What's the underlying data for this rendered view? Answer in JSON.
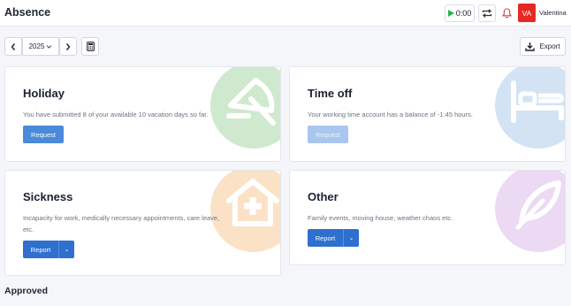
{
  "header": {
    "title": "Absence",
    "timer": "0:00",
    "avatar_initials": "VA",
    "user_name": "Valentina"
  },
  "toolbar": {
    "year": "2025",
    "export_label": "Export"
  },
  "cards": [
    {
      "title": "Holiday",
      "description": "You have submitted 8 of your available 10 vacation days so far.",
      "button": "Request",
      "color": "#cfe9cf",
      "icon": "umbrella-icon"
    },
    {
      "title": "Time off",
      "description": "Your working time account has a balance of -1:45 hours.",
      "button": "Request",
      "color": "#d3e3f3",
      "icon": "bed-icon"
    },
    {
      "title": "Sickness",
      "description_line1": "Incapacity for work, medically necessary appointments, care leave,",
      "description_line2": "etc.",
      "button": "Report",
      "color": "#fbe2c7",
      "icon": "medical-house-icon"
    },
    {
      "title": "Other",
      "description": "Family events, moving house, weather chaos etc.",
      "button": "Report",
      "color": "#ecd9f3",
      "icon": "feather-icon"
    }
  ],
  "approved_title": "Approved",
  "colors": {
    "primary": "#2e6fcf",
    "avatar": "#e42a22",
    "timer_play": "#2bb24c",
    "bell": "#e53935"
  }
}
